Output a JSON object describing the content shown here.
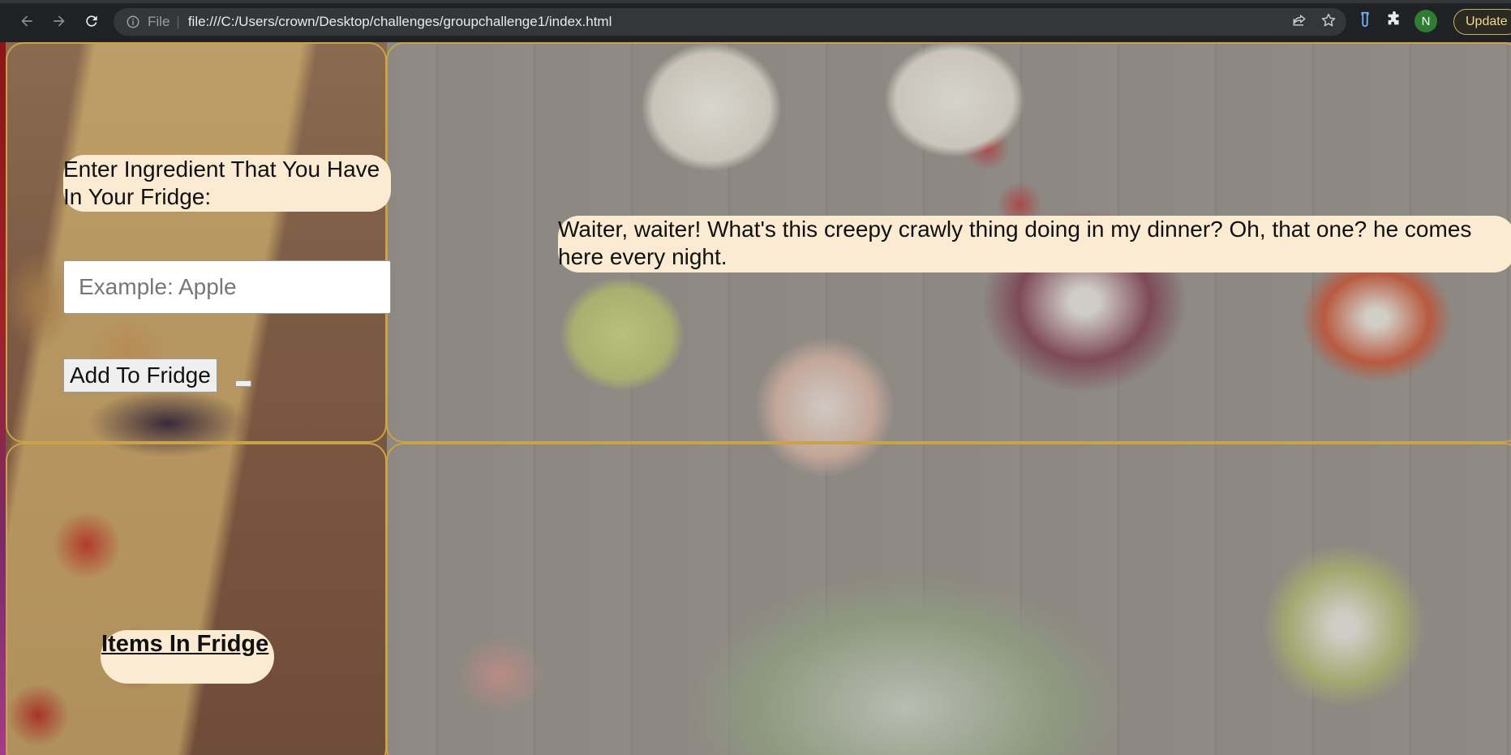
{
  "browser": {
    "url_scheme": "File",
    "url": "file:///C:/Users/crown/Desktop/challenges/groupchallenge1/index.html",
    "profile_initial": "N",
    "update_label": "Update",
    "icons": [
      "back-icon",
      "forward-icon",
      "reload-icon",
      "info-icon",
      "share-icon",
      "star-icon",
      "extension-icon",
      "puzzle-icon"
    ]
  },
  "page": {
    "ingredient_label": "Enter Ingredient That You Have In Your Fridge:",
    "ingredient_placeholder": "Example: Apple",
    "add_button_label": "Add To Fridge",
    "joke": "Waiter, waiter! What's this creepy crawly thing doing in my dinner? Oh, that one? he comes here every night.",
    "fridge_heading": "Items In Fridge",
    "accent_color": "#c9a24a",
    "pill_color": "#faebd2"
  }
}
